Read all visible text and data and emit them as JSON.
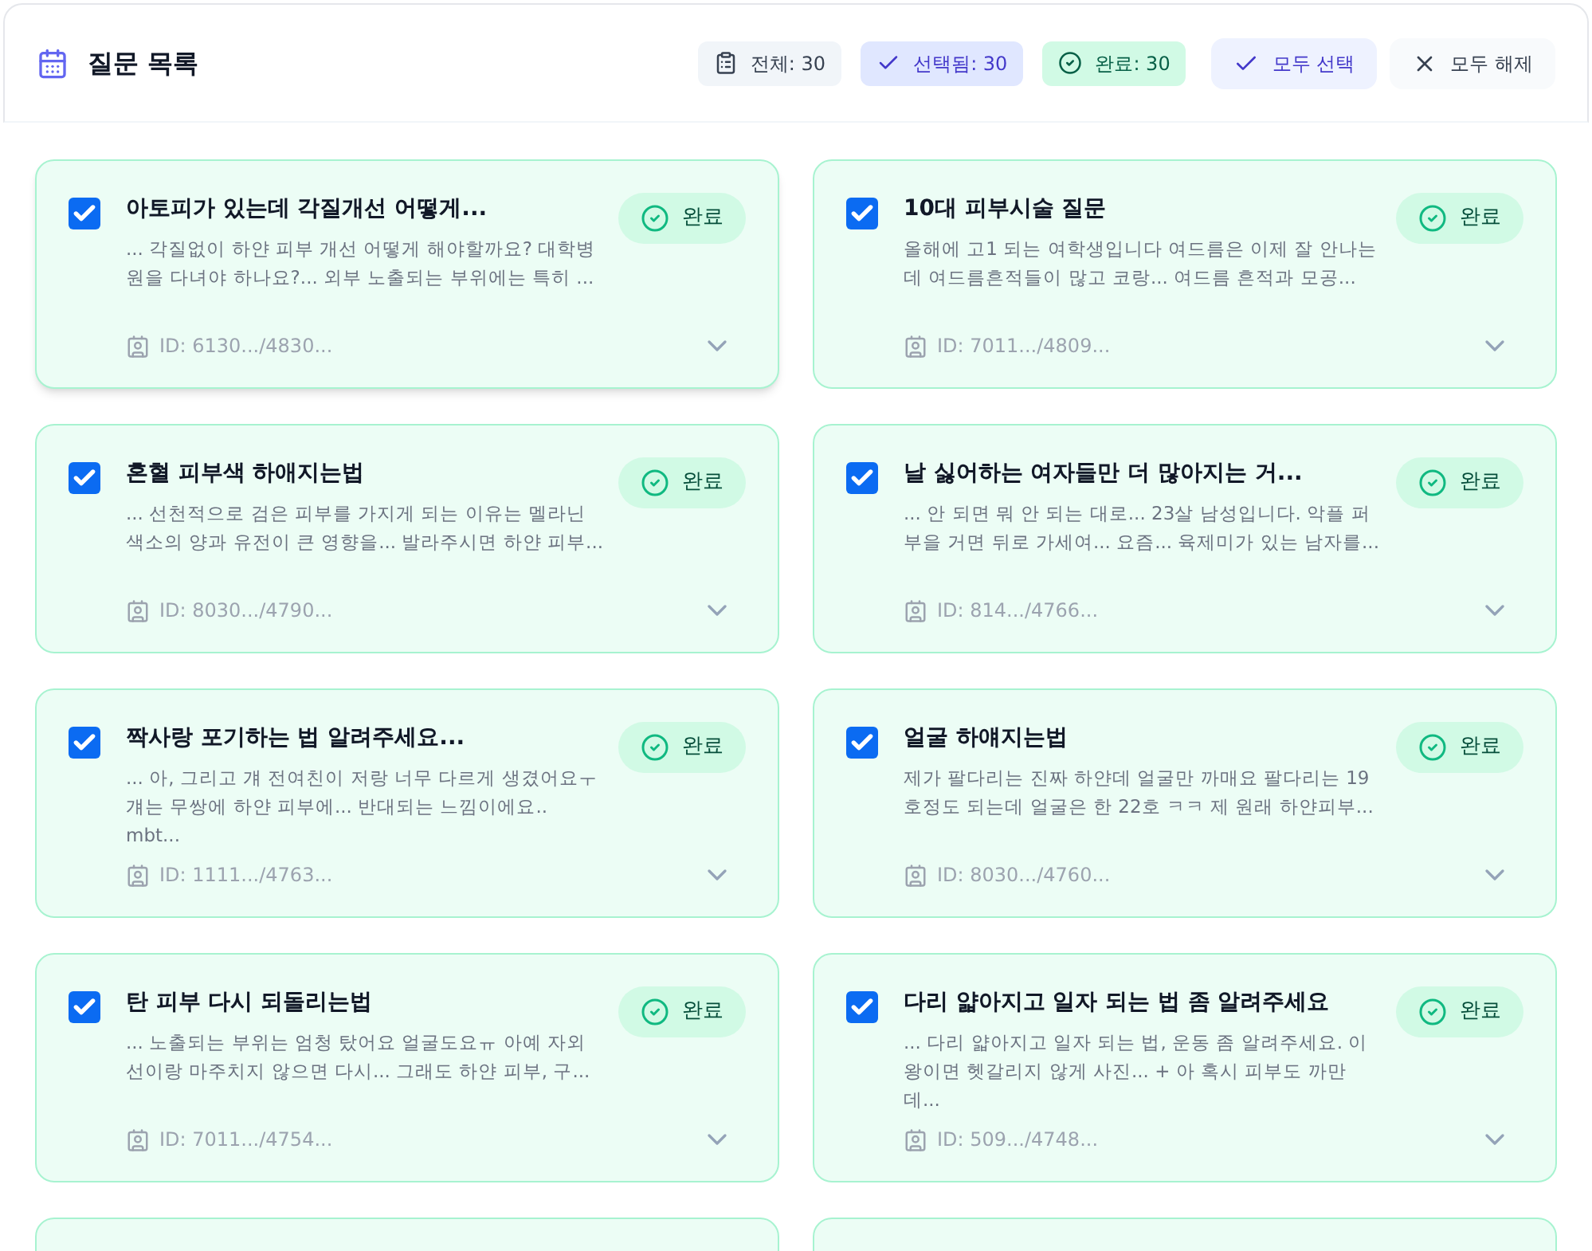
{
  "header": {
    "title": "질문 목록",
    "stats": [
      {
        "kind": "total",
        "label": "전체: 30"
      },
      {
        "kind": "selected",
        "label": "선택됨: 30"
      },
      {
        "kind": "done",
        "label": "완료: 30"
      }
    ],
    "buttons": [
      {
        "kind": "select_all",
        "label": "모두 선택"
      },
      {
        "kind": "clear_all",
        "label": "모두 해제"
      }
    ]
  },
  "cards": [
    {
      "kind": "card",
      "checked": true,
      "title": "아토피가 있는데 각질개선 어떻게...",
      "preview": "... 각질없이 하얀 피부 개선 어떻게 해야할까요? 대학병원을 다녀야 하나요?... 외부 노출되는 부위에는 특히 ...",
      "status": {
        "kind": "done",
        "label": "완료"
      },
      "id": "ID: 6130.../4830..."
    },
    {
      "kind": "card",
      "checked": true,
      "title": "10대 피부시술 질문",
      "preview": "올해에 고1 되는 여학생입니다 여드름은 이제 잘 안나는데 여드름흔적들이 많고 코랑... 여드름 흔적과 모공...",
      "status": {
        "kind": "done",
        "label": "완료"
      },
      "id": "ID: 7011.../4809..."
    },
    {
      "kind": "card",
      "checked": true,
      "title": "혼혈 피부색 하애지는법",
      "preview": "... 선천적으로 검은 피부를 가지게 되는 이유는 멜라닌 색소의 양과 유전이 큰 영향을... 발라주시면 하얀 피부...",
      "status": {
        "kind": "done",
        "label": "완료"
      },
      "id": "ID: 8030.../4790..."
    },
    {
      "kind": "card",
      "checked": true,
      "title": "날 싫어하는 여자들만 더 많아지는 거...",
      "preview": "... 안 되면 뭐 안 되는 대로... 23살 남성입니다. 악플 퍼부을 거면 뒤로 가세여... 요즘... 육제미가 있는 남자를...",
      "status": {
        "kind": "done",
        "label": "완료"
      },
      "id": "ID: 814.../4766..."
    },
    {
      "kind": "card",
      "checked": true,
      "title": "짝사랑 포기하는 법 알려주세요...",
      "preview": "... 아, 그리고 걔 전여친이 저랑 너무 다르게 생겼어요ㅜ 걔는 무쌍에 하얀 피부에... 반대되는 느낌이에요.. mbt...",
      "status": {
        "kind": "done",
        "label": "완료"
      },
      "id": "ID: 1111.../4763..."
    },
    {
      "kind": "card",
      "checked": true,
      "title": "얼굴 하얘지는법",
      "preview": "제가 팔다리는 진짜 하얀데 얼굴만 까매요 팔다리는 19호정도 되는데 얼굴은 한 22호 ㅋㅋ 제 원래 하얀피부...",
      "status": {
        "kind": "done",
        "label": "완료"
      },
      "id": "ID: 8030.../4760..."
    },
    {
      "kind": "card",
      "checked": true,
      "title": "탄 피부 다시 되돌리는법",
      "preview": "... 노출되는 부위는 엄청 탔어요 얼굴도요ㅠ 아예 자외선이랑 마주치지 않으면 다시... 그래도 하얀 피부, 구...",
      "status": {
        "kind": "done",
        "label": "완료"
      },
      "id": "ID: 7011.../4754..."
    },
    {
      "kind": "card",
      "checked": true,
      "title": "다리 얇아지고 일자 되는 법 좀 알려주세요",
      "preview": "... 다리 얇아지고 일자 되는 법, 운동 좀 알려주세요. 이왕이면 헷갈리지 않게 사진... + 아 혹시 피부도 까만데...",
      "status": {
        "kind": "done",
        "label": "완료"
      },
      "id": "ID: 509.../4748..."
    },
    {
      "kind": "cut_off"
    },
    {
      "kind": "cut_off"
    }
  ]
}
